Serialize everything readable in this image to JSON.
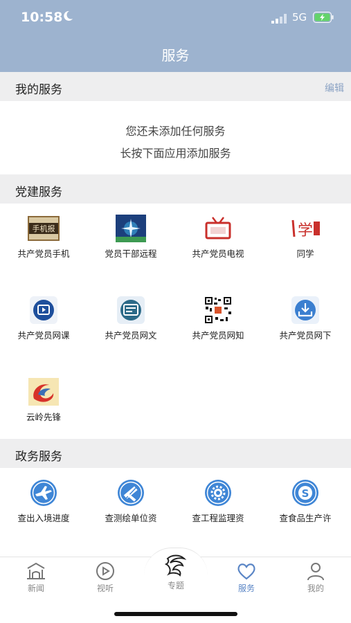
{
  "status": {
    "time": "10:58",
    "network": "5G"
  },
  "header": {
    "title": "服务"
  },
  "my_services": {
    "title": "我的服务",
    "edit_label": "编辑",
    "empty_line1": "您还未添加任何服务",
    "empty_line2": "长按下面应用添加服务"
  },
  "party": {
    "title": "党建服务",
    "apps": [
      {
        "label": "共产党员手机",
        "icon": "phone-newspaper-icon",
        "icon_text": "手机报"
      },
      {
        "label": "党员干部远程",
        "icon": "remote-learning-icon"
      },
      {
        "label": "共产党员电视",
        "icon": "tv-icon"
      },
      {
        "label": "同学",
        "icon": "study-logo-icon",
        "icon_text": "学"
      },
      {
        "label": "共产党员网课",
        "icon": "video-course-icon"
      },
      {
        "label": "共产党员网文",
        "icon": "web-article-icon"
      },
      {
        "label": "共产党员网知",
        "icon": "qr-code-icon"
      },
      {
        "label": "共产党员网下",
        "icon": "download-icon"
      },
      {
        "label": "云岭先锋",
        "icon": "yunling-logo-icon"
      }
    ]
  },
  "gov": {
    "title": "政务服务",
    "apps": [
      {
        "label": "查出入境进度",
        "icon": "airplane-icon"
      },
      {
        "label": "查测绘单位资",
        "icon": "surveying-icon"
      },
      {
        "label": "查工程监理资",
        "icon": "gear-icon"
      },
      {
        "label": "查食品生产许",
        "icon": "food-license-icon",
        "icon_text": "S"
      }
    ]
  },
  "tabbar": {
    "tabs": [
      {
        "label": "新闻",
        "icon": "news-icon"
      },
      {
        "label": "视听",
        "icon": "play-icon"
      },
      {
        "label": "专题",
        "icon": "special-topic-icon"
      },
      {
        "label": "服务",
        "icon": "heart-icon",
        "active": true
      },
      {
        "label": "我的",
        "icon": "user-icon"
      }
    ]
  },
  "colors": {
    "header_bg": "#9db3cf",
    "accent": "#5b86c6",
    "gov_icon_blue": "#3f86d6",
    "party_red": "#c9302c"
  }
}
